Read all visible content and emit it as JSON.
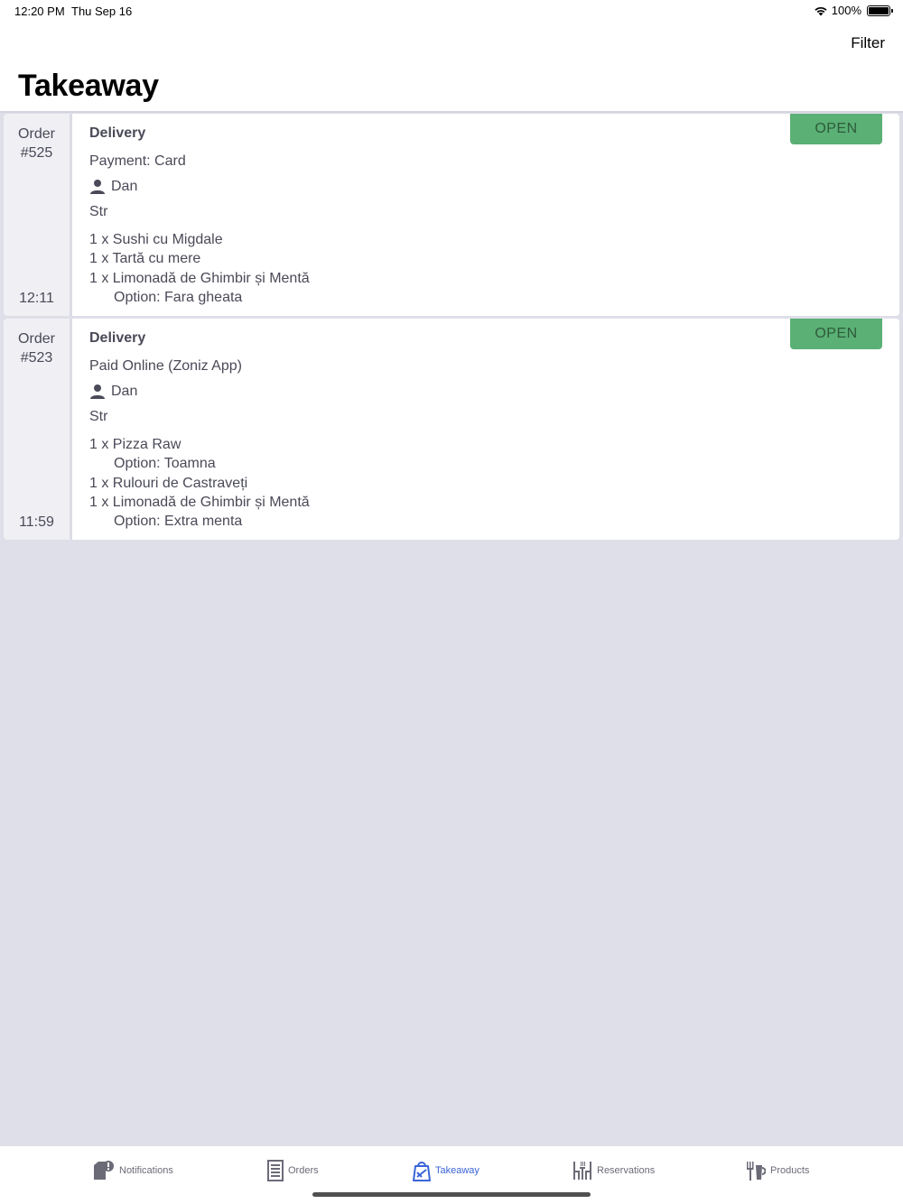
{
  "status_bar": {
    "time": "12:20 PM",
    "date": "Thu Sep 16",
    "battery": "100%"
  },
  "header": {
    "filter_label": "Filter",
    "title": "Takeaway"
  },
  "orders": [
    {
      "label": "Order",
      "number": "#525",
      "time": "12:11",
      "type": "Delivery",
      "payment": "Payment: Card",
      "customer": "Dan",
      "address": "Str",
      "status": "OPEN",
      "items": [
        {
          "text": "1 x Sushi cu Migdale"
        },
        {
          "text": "1 x Tartă cu mere"
        },
        {
          "text": "1 x Limonadă de Ghimbir și Mentă"
        },
        {
          "option": "Option: Fara gheata"
        }
      ]
    },
    {
      "label": "Order",
      "number": "#523",
      "time": "11:59",
      "type": "Delivery",
      "payment": "Paid Online (Zoniz App)",
      "customer": "Dan",
      "address": "Str",
      "status": "OPEN",
      "items": [
        {
          "text": "1 x Pizza Raw"
        },
        {
          "option": "Option: Toamna"
        },
        {
          "text": "1 x Rulouri de Castraveți"
        },
        {
          "text": "1 x Limonadă de Ghimbir și Mentă"
        },
        {
          "option": "Option: Extra menta"
        }
      ]
    }
  ],
  "tabs": [
    {
      "label": "Notifications",
      "icon": "notification-icon",
      "active": false
    },
    {
      "label": "Orders",
      "icon": "orders-icon",
      "active": false
    },
    {
      "label": "Takeaway",
      "icon": "takeaway-bag-icon",
      "active": true
    },
    {
      "label": "Reservations",
      "icon": "reservations-icon",
      "active": false
    },
    {
      "label": "Products",
      "icon": "products-icon",
      "active": false
    }
  ],
  "colors": {
    "accent": "#3a64d8",
    "status_open": "#5ab075",
    "background": "#dfdfe9"
  }
}
